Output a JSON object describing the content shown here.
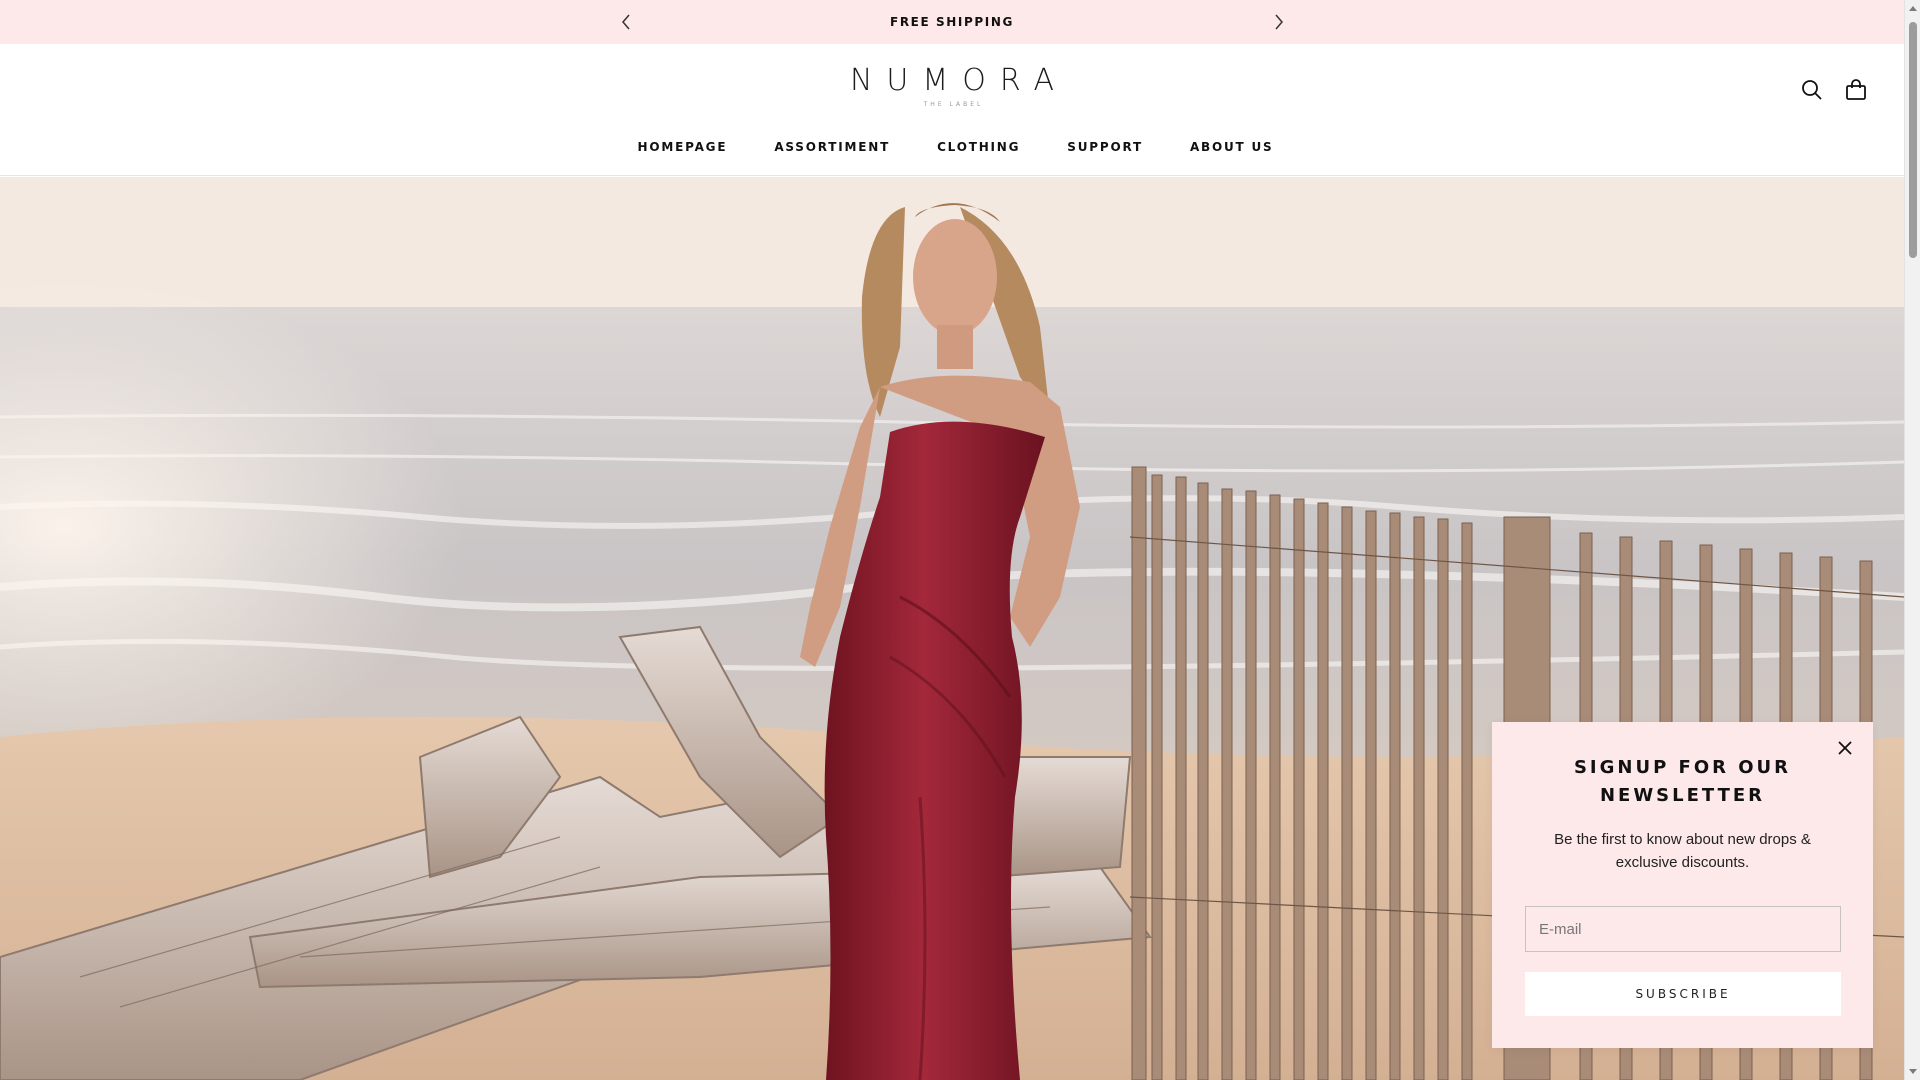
{
  "announcement": {
    "message": "FREE SHIPPING",
    "prev_icon": "chevron-left-icon",
    "next_icon": "chevron-right-icon",
    "background": "#fde8ea"
  },
  "header": {
    "brand": "NUMORA",
    "brand_sub": "THE LABEL",
    "icons": [
      "search-icon",
      "shopping-bag-icon"
    ],
    "nav": [
      "HOMEPAGE",
      "ASSORTIMENT",
      "CLOTHING",
      "SUPPORT",
      "ABOUT US"
    ]
  },
  "hero": {
    "dress_color": "#8e1f2c"
  },
  "newsletter": {
    "title": "SIGNUP FOR OUR NEWSLETTER",
    "description": "Be the first to know about new drops & exclusive discounts.",
    "email_placeholder": "E-mail",
    "email_value": "",
    "button_label": "SUBSCRIBE",
    "close_icon": "close-icon",
    "background": "#fde8ea"
  }
}
